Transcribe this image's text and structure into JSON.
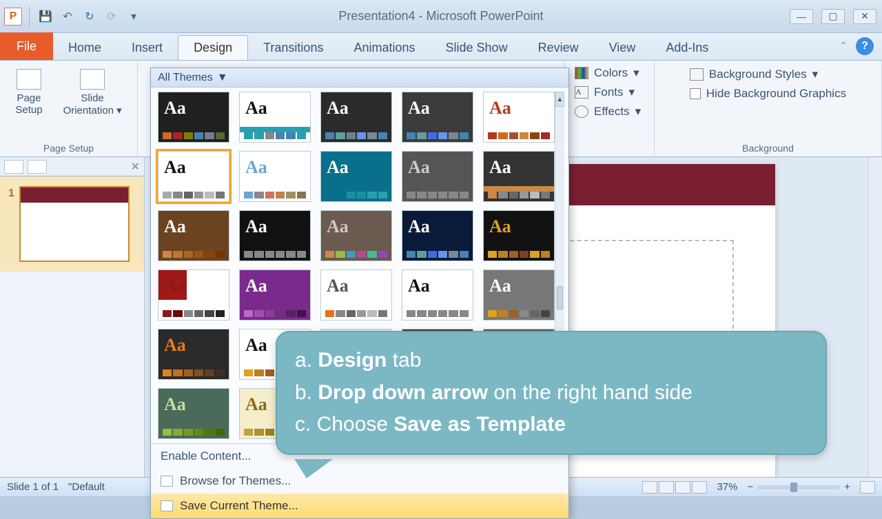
{
  "window": {
    "title": "Presentation4 - Microsoft PowerPoint",
    "app_letter": "P"
  },
  "tabs": {
    "file": "File",
    "home": "Home",
    "insert": "Insert",
    "design": "Design",
    "transitions": "Transitions",
    "animations": "Animations",
    "slideshow": "Slide Show",
    "review": "Review",
    "view": "View",
    "addins": "Add-Ins"
  },
  "ribbon": {
    "pagesetup": {
      "page_setup": "Page\nSetup",
      "slide_orientation": "Slide\nOrientation",
      "group": "Page Setup"
    },
    "themes_gallery_title": "All Themes",
    "variants": {
      "colors": "Colors",
      "fonts": "Fonts",
      "effects": "Effects"
    },
    "background": {
      "styles": "Background Styles",
      "hide": "Hide Background Graphics",
      "group": "Background"
    }
  },
  "gallery": {
    "footer": {
      "enable": "Enable Content...",
      "browse": "Browse for Themes...",
      "save": "Save Current Theme..."
    },
    "themes": [
      {
        "bg": "#202020",
        "fg": "#ffffff",
        "pal": [
          "#d2691e",
          "#b22222",
          "#808000",
          "#4682b4",
          "#708090",
          "#556b2f"
        ]
      },
      {
        "bg": "#ffffff",
        "fg": "#111",
        "accent": "#2a9fb0",
        "pal": [
          "#2a9fb0",
          "#2a9fb0",
          "#888",
          "#4682b4",
          "#4682b4",
          "#2a9fb0"
        ]
      },
      {
        "bg": "#2b2b2b",
        "fg": "#fff",
        "pal": [
          "#4682b4",
          "#5f9ea0",
          "#708090",
          "#6495ed",
          "#778899",
          "#4682b4"
        ]
      },
      {
        "bg": "#3b3b3b",
        "fg": "#fff",
        "pal": [
          "#4682b4",
          "#5f9ea0",
          "#4169e1",
          "#6495ed",
          "#778899",
          "#4682b4"
        ]
      },
      {
        "bg": "#ffffff",
        "fg": "#b23a1a",
        "pal": [
          "#b23a1a",
          "#d2691e",
          "#a0522d",
          "#cd853f",
          "#8b4513",
          "#a52a2a"
        ]
      },
      {
        "bg": "#ffffff",
        "fg": "#111",
        "sel": true,
        "pal": [
          "#aaa",
          "#888",
          "#666",
          "#999",
          "#bbb",
          "#777"
        ]
      },
      {
        "bg": "#ffffff",
        "fg": "#6aa5d0",
        "pal": [
          "#6aa5d0",
          "#888",
          "#d07060",
          "#c08050",
          "#a09060",
          "#907050"
        ]
      },
      {
        "bg": "#0a6f8a",
        "fg": "#fff",
        "pal": [
          "#0a6f8a",
          "#0a6f8a",
          "#1a8fa0",
          "#1a8fa0",
          "#2a9fb0",
          "#2a9fb0"
        ]
      },
      {
        "bg": "#555",
        "fg": "#ccc",
        "pal": [
          "#888",
          "#888",
          "#888",
          "#888",
          "#888",
          "#888"
        ]
      },
      {
        "bg": "#333",
        "fg": "#fff",
        "accent": "#c84",
        "pal": [
          "#c84",
          "#888",
          "#666",
          "#999",
          "#bbb",
          "#777"
        ]
      },
      {
        "bg": "#6b4320",
        "fg": "#fff",
        "pal": [
          "#c84",
          "#b73",
          "#a62",
          "#951",
          "#840",
          "#730"
        ]
      },
      {
        "bg": "#111",
        "fg": "#fff",
        "pal": [
          "#888",
          "#888",
          "#888",
          "#888",
          "#888",
          "#888"
        ]
      },
      {
        "bg": "#6a5a50",
        "fg": "#d0c8c0",
        "pal": [
          "#c84",
          "#9b4",
          "#49b",
          "#b49",
          "#4b9",
          "#94b"
        ]
      },
      {
        "bg": "#0a1a3a",
        "fg": "#fff",
        "pal": [
          "#4682b4",
          "#5f9ea0",
          "#4169e1",
          "#6495ed",
          "#778899",
          "#4682b4"
        ]
      },
      {
        "bg": "#111",
        "fg": "#e0a020",
        "pal": [
          "#e0a020",
          "#c08020",
          "#a06020",
          "#804020",
          "#e0a020",
          "#c08020"
        ]
      },
      {
        "bg": "#fff",
        "fg": "#8a1a1a",
        "accentbg": "#a01818",
        "pal": [
          "#8a1a1a",
          "#6a0a0a",
          "#888",
          "#666",
          "#444",
          "#222"
        ]
      },
      {
        "bg": "#7a2a8a",
        "fg": "#fff",
        "pal": [
          "#b86ac8",
          "#a050b0",
          "#884098",
          "#703080",
          "#582068",
          "#401050"
        ]
      },
      {
        "bg": "#ffffff",
        "fg": "#555",
        "pal": [
          "#e87020",
          "#888",
          "#666",
          "#999",
          "#bbb",
          "#777"
        ]
      },
      {
        "bg": "#ffffff",
        "fg": "#111",
        "pal": [
          "#888",
          "#888",
          "#888",
          "#888",
          "#888",
          "#888"
        ]
      },
      {
        "bg": "#777",
        "fg": "#fff",
        "pal": [
          "#e0a020",
          "#c08020",
          "#a06020",
          "#888",
          "#666",
          "#444"
        ]
      },
      {
        "bg": "#2a2a2a",
        "fg": "#e08020",
        "pal": [
          "#e08020",
          "#c07020",
          "#a06020",
          "#805020",
          "#604020",
          "#403020"
        ]
      },
      {
        "bg": "#ffffff",
        "fg": "#111",
        "pal": [
          "#e0a020",
          "#c08020",
          "#a06020",
          "#888",
          "#666",
          "#444"
        ]
      },
      {
        "bg": "#d8e6ec",
        "fg": "#5a6b7c",
        "pal": [
          "#5a6b7c",
          "#5a6b7c",
          "#5a6b7c",
          "#5a6b7c",
          "#5a6b7c",
          "#5a6b7c"
        ]
      },
      {
        "bg": "#3a3a3a",
        "fg": "#bbb",
        "pal": [
          "#888",
          "#888",
          "#888",
          "#888",
          "#888",
          "#888"
        ]
      },
      {
        "bg": "#555",
        "fg": "#ddd",
        "pal": [
          "#888",
          "#888",
          "#888",
          "#888",
          "#888",
          "#888"
        ]
      },
      {
        "bg": "#4a6a5a",
        "fg": "#c0e0a0",
        "pal": [
          "#9b4",
          "#8a3",
          "#792",
          "#681",
          "#570",
          "#460"
        ]
      },
      {
        "bg": "#f4eecb",
        "fg": "#8a6a1a",
        "pal": [
          "#c0a040",
          "#b09030",
          "#a08020",
          "#907010",
          "#806000",
          "#705000"
        ]
      }
    ]
  },
  "slides": {
    "current_num": "1"
  },
  "callout": {
    "a_prefix": "a. ",
    "a_bold": "Design",
    "a_rest": " tab",
    "b_prefix": "b. ",
    "b_bold": "Drop down arrow",
    "b_rest": " on the right hand side",
    "c_prefix": "c. Choose ",
    "c_bold": "Save as Template",
    "c_rest": ""
  },
  "status": {
    "slide": "Slide 1 of 1",
    "theme": "\"Default",
    "zoom": "37%"
  }
}
